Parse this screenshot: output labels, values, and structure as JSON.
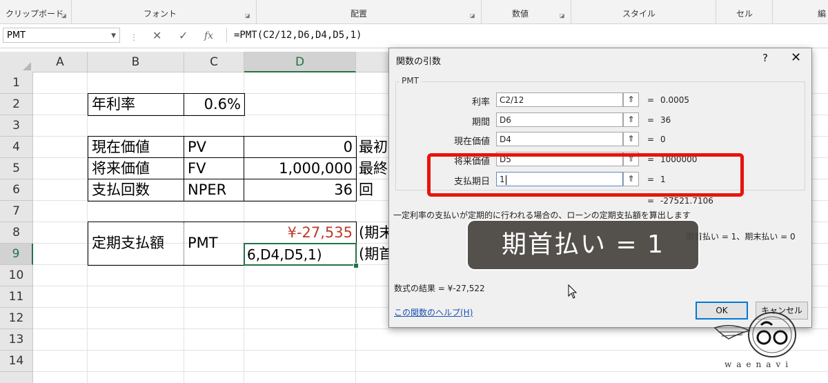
{
  "ribbon": {
    "groups": [
      "クリップボード",
      "フォント",
      "配置",
      "数値",
      "スタイル",
      "セル",
      "編"
    ]
  },
  "formula_bar": {
    "name_box": "PMT",
    "formula": "=PMT(C2/12,D6,D4,D5,1)",
    "fx_symbol": "fx",
    "cancel_symbol": "✕",
    "enter_symbol": "✓"
  },
  "sheet": {
    "columns": [
      "A",
      "B",
      "C",
      "D"
    ],
    "rows": [
      "1",
      "2",
      "3",
      "4",
      "5",
      "6",
      "7",
      "8",
      "9",
      "10",
      "11",
      "12",
      "13",
      "14"
    ],
    "cells": {
      "b2": "年利率",
      "c2": "0.6%",
      "b4": "現在価値",
      "c4": "PV",
      "d4": "0",
      "e4": "最初",
      "b5": "将来価値",
      "c5": "FV",
      "d5": "1,000,000",
      "e5": "最終",
      "b6": "支払回数",
      "c6": "NPER",
      "d6": "36",
      "e6": "回",
      "b8": "定期支払額",
      "c8": "PMT",
      "d8": "¥-27,535",
      "e8": "(期末",
      "d9": "6,D4,D5,1)",
      "e9": "(期首"
    }
  },
  "dialog": {
    "title": "関数の引数",
    "help_symbol": "?",
    "close_symbol": "✕",
    "function_name": "PMT",
    "args": [
      {
        "label": "利率",
        "input": "C2/12",
        "value": "0.0005"
      },
      {
        "label": "期間",
        "input": "D6",
        "value": "36"
      },
      {
        "label": "現在価値",
        "input": "D4",
        "value": "0"
      },
      {
        "label": "将来価値",
        "input": "D5",
        "value": "1000000"
      },
      {
        "label": "支払期日",
        "input": "1",
        "value": "1"
      }
    ],
    "ref_button": "⇑",
    "equals": "=",
    "formula_value": "-27521.7106",
    "description": "一定利率の支払いが定期的に行われる場合の、ローンの定期支払額を算出します",
    "arg_description": "期首払い = 1、期末払い = 0",
    "result": "数式の結果 =  ¥-27,522",
    "help_link": "この関数のヘルプ(H)",
    "ok_label": "OK",
    "cancel_label": "キャンセル"
  },
  "caption": "期首払い = 1",
  "watermark": {
    "text": "waenavi"
  },
  "colors": {
    "accent_green": "#217346",
    "highlight_red": "#e8140c",
    "negative_red": "#c0392b"
  }
}
